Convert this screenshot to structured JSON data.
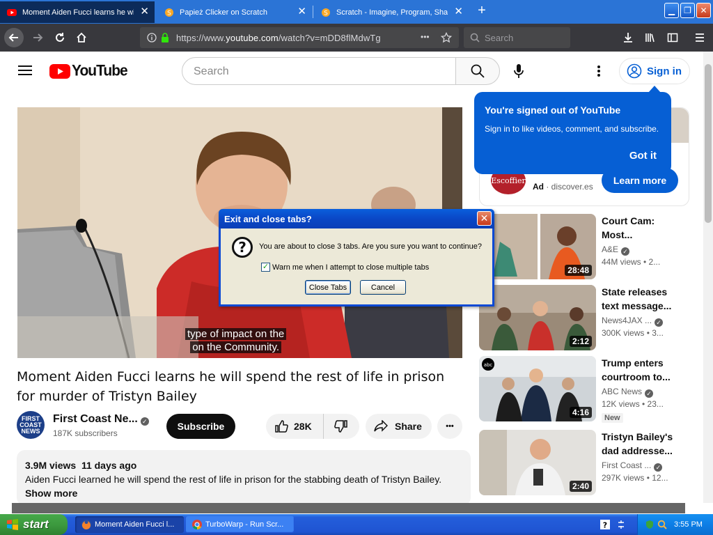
{
  "browser": {
    "tabs": [
      {
        "title": "Moment Aiden Fucci learns he will s",
        "active": true,
        "close": "✕"
      },
      {
        "title": "Papież Clicker on Scratch",
        "active": false,
        "close": "✕"
      },
      {
        "title": "Scratch - Imagine, Program, Share",
        "active": false,
        "close": "✕"
      }
    ],
    "new_tab": "+",
    "url_prefix": "https://www.",
    "url_domain": "youtube.com",
    "url_path": "/watch?v=mDD8flMdwTg",
    "url_more": "•••",
    "search_placeholder": "Search",
    "window_buttons": {
      "minimize": "▁",
      "restore": "❐",
      "close": "✕"
    }
  },
  "youtube": {
    "logo_text": "YouTube",
    "search_placeholder": "Search",
    "sign_in": "Sign in",
    "caption_line1": "type of impact on the",
    "caption_line2": "on the Community.",
    "video_title": "Moment Aiden Fucci learns he will spend the rest of life in prison for murder of Tristyn Bailey",
    "channel": {
      "avatar_text": "FIRST COAST NEWS",
      "name": "First Coast Ne...",
      "subscribers": "187K subscribers"
    },
    "subscribe": "Subscribe",
    "likes": "28K",
    "share": "Share",
    "more": "•••",
    "description": {
      "views": "3.9M views",
      "date": "11 days ago",
      "text": "Aiden Fucci learned he will spend the rest of life in prison for the stabbing death of Tristyn Bailey.",
      "show_more": "Show more"
    },
    "ad": {
      "logo": "Escoffier",
      "label": "Ad",
      "domain": "discover.es",
      "cta": "Learn more"
    },
    "tooltip": {
      "title": "You're signed out of YouTube",
      "body": "Sign in to like videos, comment, and subscribe.",
      "button": "Got it"
    },
    "recommendations": [
      {
        "title": "Court Cam: Most...",
        "channel": "A&E",
        "meta": "44M views  • 2...",
        "duration": "28:48",
        "new": ""
      },
      {
        "title": "State releases text message...",
        "channel": "News4JAX ...",
        "meta": "300K views  • 3...",
        "duration": "2:12",
        "new": ""
      },
      {
        "title": "Trump enters courtroom to...",
        "channel": "ABC News",
        "meta": "12K views  • 23...",
        "duration": "4:16",
        "new": "New"
      },
      {
        "title": "Tristyn Bailey's dad addresse...",
        "channel": "First Coast ...",
        "meta": "297K views  • 12...",
        "duration": "2:40",
        "new": ""
      }
    ]
  },
  "dialog": {
    "title": "Exit and close tabs?",
    "message": "You are about to close 3 tabs. Are you sure you want to continue?",
    "checkbox_label": "Warn me when I attempt to close multiple tabs",
    "checkbox_checked": true,
    "close_tabs": "Close Tabs",
    "cancel": "Cancel"
  },
  "taskbar": {
    "start": "start",
    "tasks": [
      {
        "label": "Moment Aiden Fucci l...",
        "active": true
      },
      {
        "label": "TurboWarp - Run Scr...",
        "active": false
      }
    ],
    "clock": "3:55 PM"
  }
}
